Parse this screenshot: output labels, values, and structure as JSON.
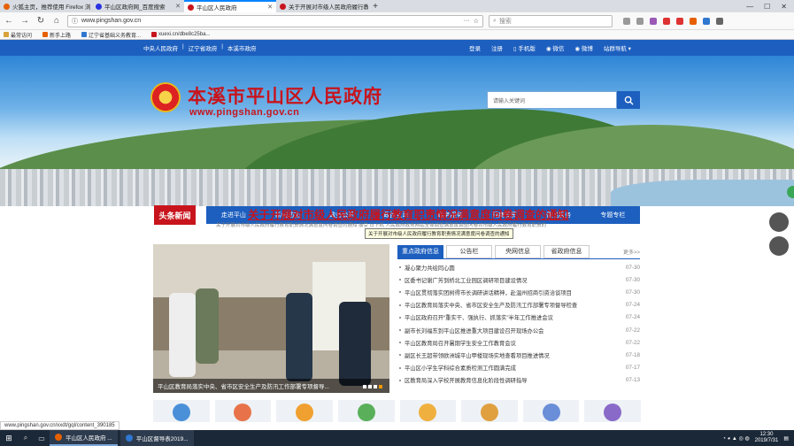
{
  "browser": {
    "tabs": [
      {
        "label": "火狐主页，推荐使用 Firefox 浏",
        "color": "#e66000"
      },
      {
        "label": "平山区政府网_百度搜索",
        "color": "#2932e1"
      },
      {
        "label": "平山区人民政府",
        "color": "#c8141c"
      },
      {
        "label": "关于开展对市级人民政府履行教",
        "color": "#c8141c"
      }
    ],
    "new_tab": "+",
    "url": "www.pingshan.gov.cn",
    "search_placeholder": "搜索",
    "bookmarks": [
      {
        "label": "最常访问",
        "color": "#d7a23a"
      },
      {
        "label": "新手上路",
        "color": "#e66000"
      },
      {
        "label": "辽宁省基础义务教育...",
        "color": "#2f77d0"
      },
      {
        "label": "xuexi.cn/dbe8c25ba...",
        "color": "#c8141c"
      }
    ]
  },
  "site": {
    "top_links": [
      "中央人民政府",
      "|",
      "辽宁省政府",
      "|",
      "本溪市政府"
    ],
    "top_right": [
      "登录",
      "注册",
      "手机版",
      "微信",
      "微博",
      "站群导航"
    ],
    "title": "本溪市平山区人民政府",
    "url_text": "www.pingshan.gov.cn",
    "search_placeholder": "请输入关键词",
    "nav": [
      "网站首页",
      "走进平山",
      "新闻动态",
      "政务公开",
      "政民互动",
      "政务服务",
      "招商投资",
      "便民服务",
      "专题专栏"
    ],
    "headline_badge": "头条新闻",
    "headline_title": "关于开展对市级人民政府履行教育职责情况满意度问卷调查的通知",
    "headline_sub": "关于开展对市级人民政府履行教育职责情况满意度问卷调查的通知 接受 日下机 人民政府政务网站全体调查满意度调查问卷对市级人民政府履行教育职责的",
    "tooltip": "关于开展对市级人民政府履行教育职责情况满意度问卷调查的通知",
    "photo_caption": "平山区教育局落实中央、省市区安全生产及防汛工作部署专项督导...",
    "news_tabs": [
      "重点政府信息",
      "公告栏",
      "央网信息",
      "省政府信息"
    ],
    "news_more": "更多>>",
    "news": [
      {
        "t": "凝心聚力共绘同心圆",
        "d": "07-30"
      },
      {
        "t": "区委书记谢广芳到桥北工业园区调研项目建设情况",
        "d": "07-30"
      },
      {
        "t": "平山区贯彻落实团树得市长调研讲话精神，赴温州招商引资洽谈项目",
        "d": "07-30"
      },
      {
        "t": "平山区教育局落实中央、省市区安全生产及防汛工作部署专项督导检查",
        "d": "07-24"
      },
      {
        "t": "平山区政府召开“重实干、强执行、抓落实”半年工作推进会议",
        "d": "07-24"
      },
      {
        "t": "副市长刘福东到平山区推进重大项目建设召开现场办公会",
        "d": "07-22"
      },
      {
        "t": "平山区教育局召开暑期学生安全工作教育会议",
        "d": "07-22"
      },
      {
        "t": "副区长王超带领欧洲城平山甲楼现场实地查看项目推进情况",
        "d": "07-18"
      },
      {
        "t": "平山区小学生学科综合素质检测工作圆满完成",
        "d": "07-17"
      },
      {
        "t": "区教育局深入学校开展教育信息化阶段性调研指导",
        "d": "07-13"
      }
    ],
    "icon_colors": [
      "#4a90d9",
      "#e8734a",
      "#f0a030",
      "#5ab05a",
      "#f0b040",
      "#e0a040",
      "#6a8ed8",
      "#8a6ac8"
    ]
  },
  "status_url": "www.pingshan.gov.cn/xxdt/gql/content_390185",
  "taskbar": {
    "apps": [
      "平山区人民政府 ...",
      "平山区督导表2019..."
    ],
    "time": "12:30",
    "date": "2019/7/31"
  }
}
